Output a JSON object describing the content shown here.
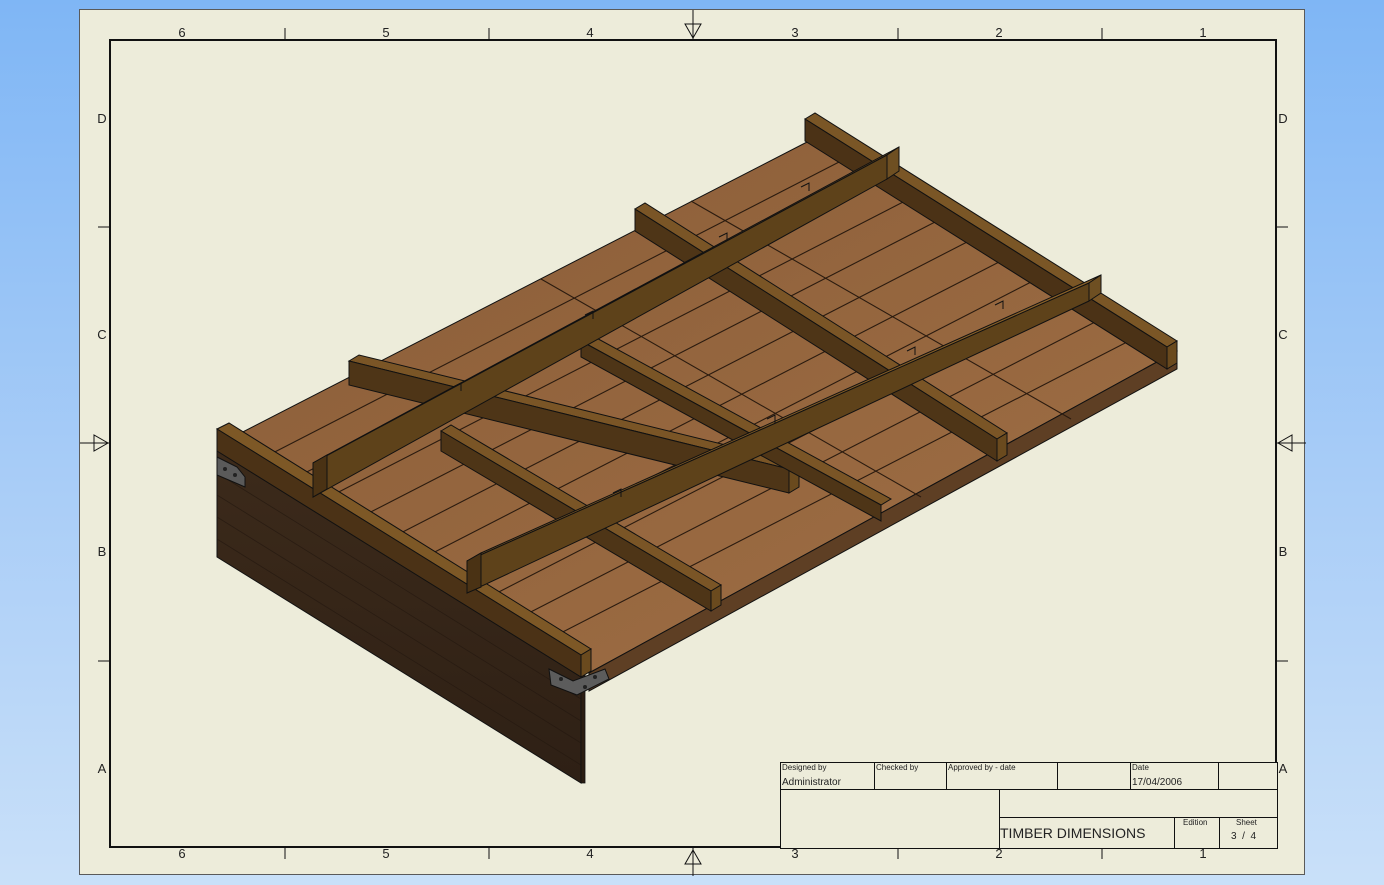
{
  "colors": {
    "sheet_background": "#edecda",
    "page_background": "#8fc0f6",
    "wood_dark": "#3a2a1c",
    "wood_mid": "#7a5533",
    "wood_light": "#9b6c43",
    "joist": "#6a4a1e",
    "bracket": "#555555"
  },
  "border_zones": {
    "columns": [
      "6",
      "5",
      "4",
      "3",
      "2",
      "1"
    ],
    "rows": [
      "D",
      "C",
      "B",
      "A"
    ]
  },
  "title_block": {
    "designed_by_label": "Designed by",
    "designed_by_value": "Administrator",
    "checked_by_label": "Checked by",
    "approved_by_label": "Approved by - date",
    "date_label": "Date",
    "date_value": "17/04/2006",
    "title": "TIMBER DIMENSIONS",
    "edition_label": "Edition",
    "sheet_label": "Sheet",
    "sheet_value": "3  /  4"
  }
}
